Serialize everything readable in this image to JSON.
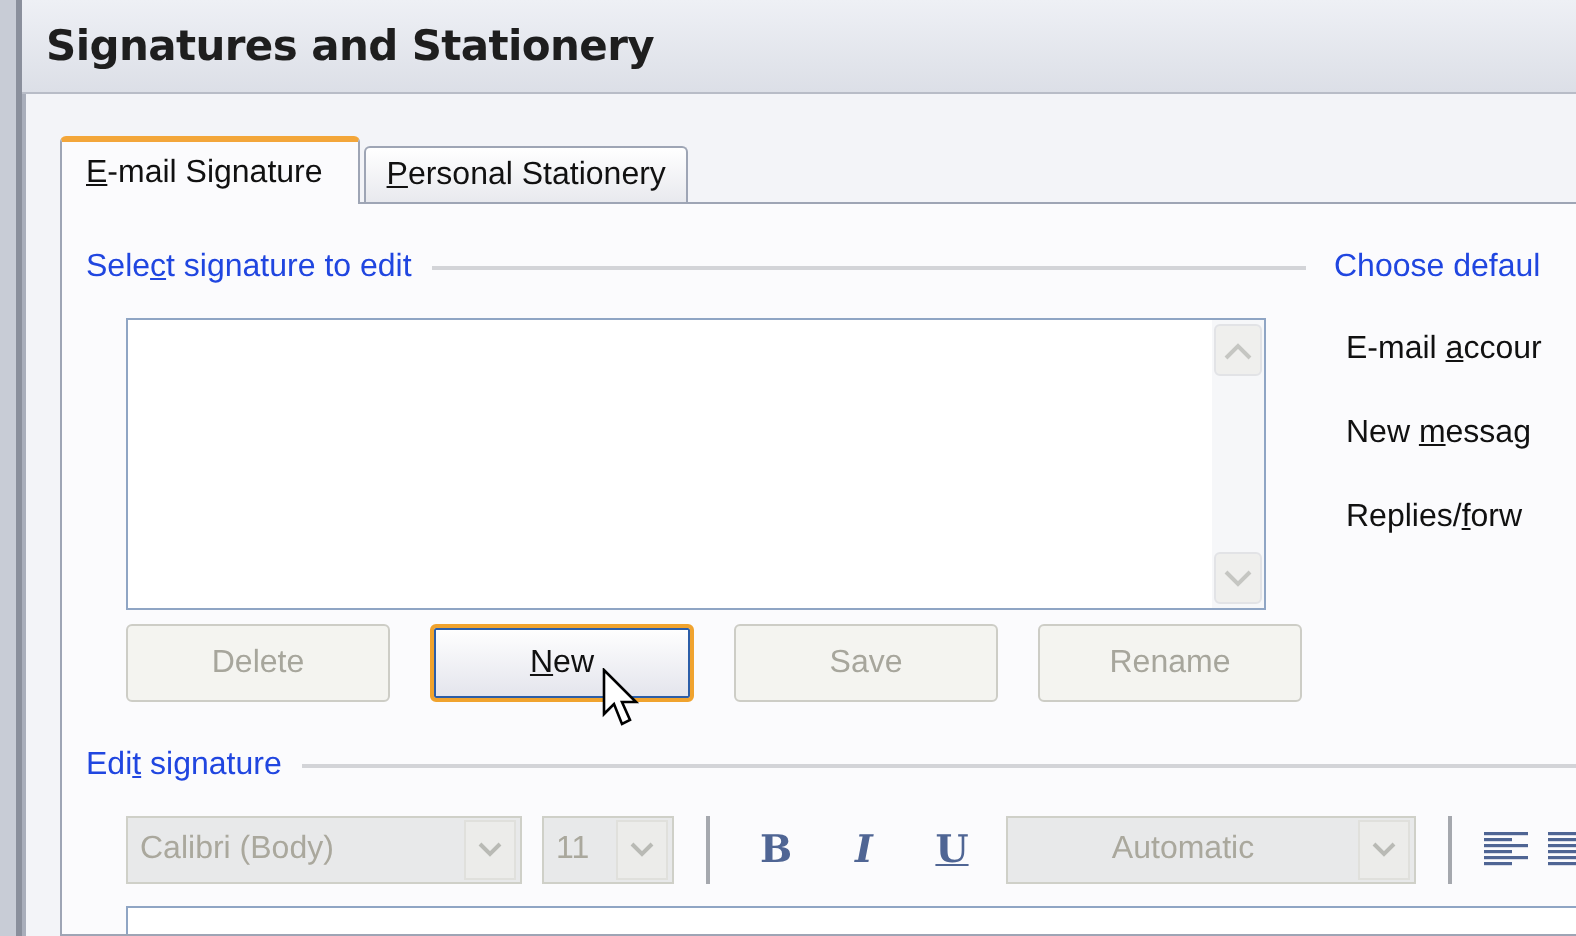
{
  "window": {
    "title": "Signatures and Stationery"
  },
  "tabs": [
    {
      "label": {
        "key": "E",
        "after": "-mail Signature"
      },
      "selected": true
    },
    {
      "label": {
        "key": "P",
        "after": "ersonal Stationery"
      },
      "selected": false
    }
  ],
  "select_section": {
    "heading": {
      "before": "Sele",
      "key": "c",
      "after": "t signature to edit"
    }
  },
  "defaults_section": {
    "heading": {
      "before": "Choose defaul"
    },
    "fields": [
      {
        "label": {
          "before": "E-mail ",
          "key": "a",
          "after": "ccour"
        }
      },
      {
        "label": {
          "before": "New ",
          "key": "m",
          "after": "essag"
        }
      },
      {
        "label": {
          "before": "Replies/",
          "key": "f",
          "after": "orw"
        }
      }
    ]
  },
  "signature_buttons": [
    {
      "label": {
        "before": "Delete"
      },
      "disabled": true,
      "focused": false
    },
    {
      "label": {
        "key": "N",
        "after": "ew"
      },
      "disabled": false,
      "focused": true
    },
    {
      "label": {
        "before": "Save"
      },
      "disabled": true,
      "focused": false
    },
    {
      "label": {
        "before": "Rename"
      },
      "disabled": true,
      "focused": false
    }
  ],
  "edit_section": {
    "heading": {
      "before": "Edi",
      "key": "t",
      "after": " signature"
    }
  },
  "toolbar": {
    "font": {
      "value": "Calibri (Body)",
      "disabled": true
    },
    "size": {
      "value": "11",
      "disabled": true
    },
    "format_buttons": [
      {
        "kind": "bold",
        "label": "B"
      },
      {
        "kind": "italic",
        "label": "I"
      },
      {
        "kind": "underline",
        "label": "U"
      }
    ],
    "color": {
      "value": "Automatic",
      "disabled": true
    }
  }
}
